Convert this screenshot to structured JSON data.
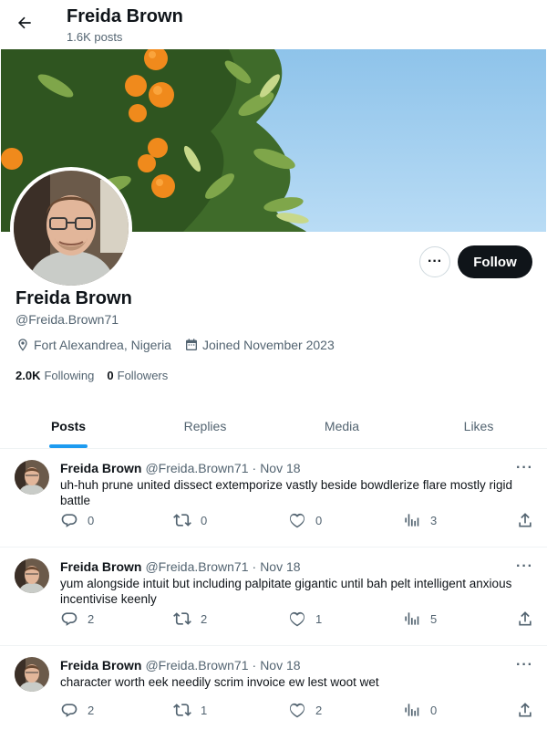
{
  "header": {
    "name": "Freida Brown",
    "post_count": "1.6K posts"
  },
  "profile": {
    "name": "Freida Brown",
    "handle": "@Freida.Brown71",
    "location": "Fort Alexandrea, Nigeria",
    "joined": "Joined November 2023",
    "following_count": "2.0K",
    "following_label": "Following",
    "followers_count": "0",
    "followers_label": "Followers",
    "more_label": "···",
    "follow_label": "Follow"
  },
  "tabs": [
    {
      "label": "Posts",
      "active": true
    },
    {
      "label": "Replies",
      "active": false
    },
    {
      "label": "Media",
      "active": false
    },
    {
      "label": "Likes",
      "active": false
    }
  ],
  "posts": [
    {
      "name": "Freida Brown",
      "handle": "@Freida.Brown71",
      "dot": "·",
      "date": "Nov 18",
      "more": "···",
      "text": "uh-huh prune united dissect extemporize vastly beside bowdlerize flare mostly rigid battle",
      "replies": "0",
      "reposts": "0",
      "likes": "0",
      "views": "3"
    },
    {
      "name": "Freida Brown",
      "handle": "@Freida.Brown71",
      "dot": "·",
      "date": "Nov 18",
      "more": "···",
      "text": "yum alongside intuit but including palpitate gigantic until bah pelt intelligent anxious incentivise keenly",
      "replies": "2",
      "reposts": "2",
      "likes": "1",
      "views": "5"
    },
    {
      "name": "Freida Brown",
      "handle": "@Freida.Brown71",
      "dot": "·",
      "date": "Nov 18",
      "more": "···",
      "text": "character worth eek needily scrim invoice ew lest woot wet",
      "replies": "2",
      "reposts": "1",
      "likes": "2",
      "views": "0"
    }
  ],
  "icons": {
    "back": "arrow-left-icon",
    "location": "map-pin-icon",
    "calendar": "calendar-icon",
    "reply": "reply-icon",
    "repost": "repost-icon",
    "like": "heart-icon",
    "views": "views-icon",
    "share": "share-icon"
  },
  "colors": {
    "accent": "#1d9bf0",
    "text": "#0f1419",
    "muted": "#536471",
    "follow_bg": "#0f1419"
  }
}
